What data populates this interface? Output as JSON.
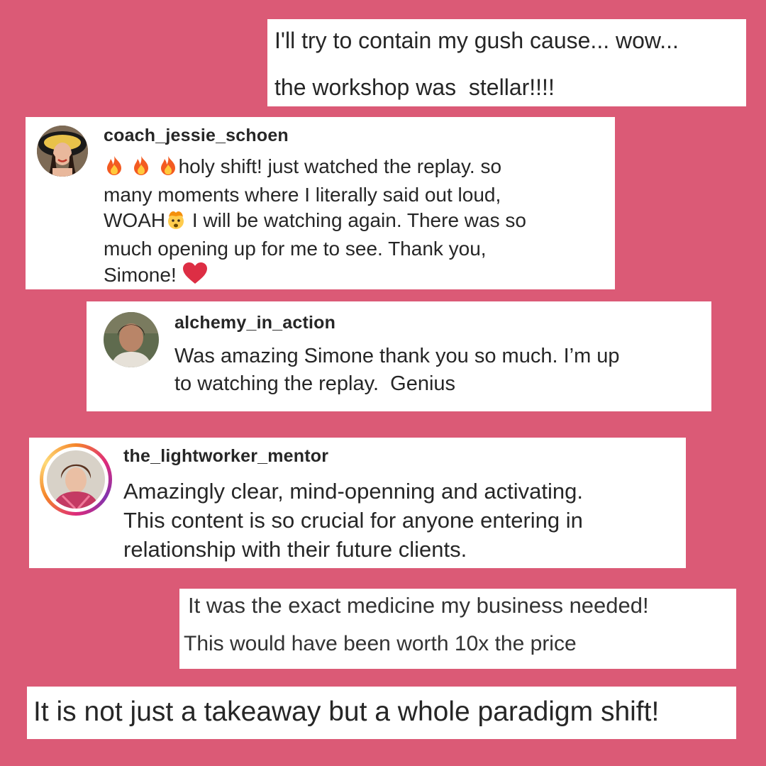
{
  "background_color": "#db5a76",
  "card_1": {
    "line_1": "I'll try to contain my gush cause... wow...",
    "line_2": "the workshop was  stellar!!!!"
  },
  "card_2": {
    "username": "coach_jessie_schoen",
    "avatar_icon": "avatar-photo-woman-hat",
    "lines": [
      "holy shift! just watched the replay. so",
      "many moments where I literally said out loud,",
      "WOAH",
      " I will be watching again. There was so",
      "much opening up for me to see. Thank you,",
      "Simone!"
    ],
    "emoji_icons": [
      "fire-emoji",
      "fire-emoji",
      "fire-emoji",
      "mind-blown-emoji",
      "red-heart-emoji"
    ]
  },
  "card_3": {
    "username": "alchemy_in_action",
    "avatar_icon": "avatar-photo-woman",
    "lines": [
      "Was amazing Simone thank you so much. I’m up",
      "to watching the replay.  Genius"
    ]
  },
  "card_4": {
    "username": "the_lightworker_mentor",
    "avatar_icon": "avatar-photo-woman-story-ring",
    "lines": [
      "Amazingly clear, mind-openning and activating.",
      "This content is so crucial for anyone entering in",
      "relationship with their future clients."
    ]
  },
  "card_5": {
    "line_1": "It was the exact medicine my business needed!",
    "line_2": "This would have been worth 10x the price"
  },
  "card_6": {
    "line_1": "It is not just a takeaway but a whole paradigm shift!"
  }
}
